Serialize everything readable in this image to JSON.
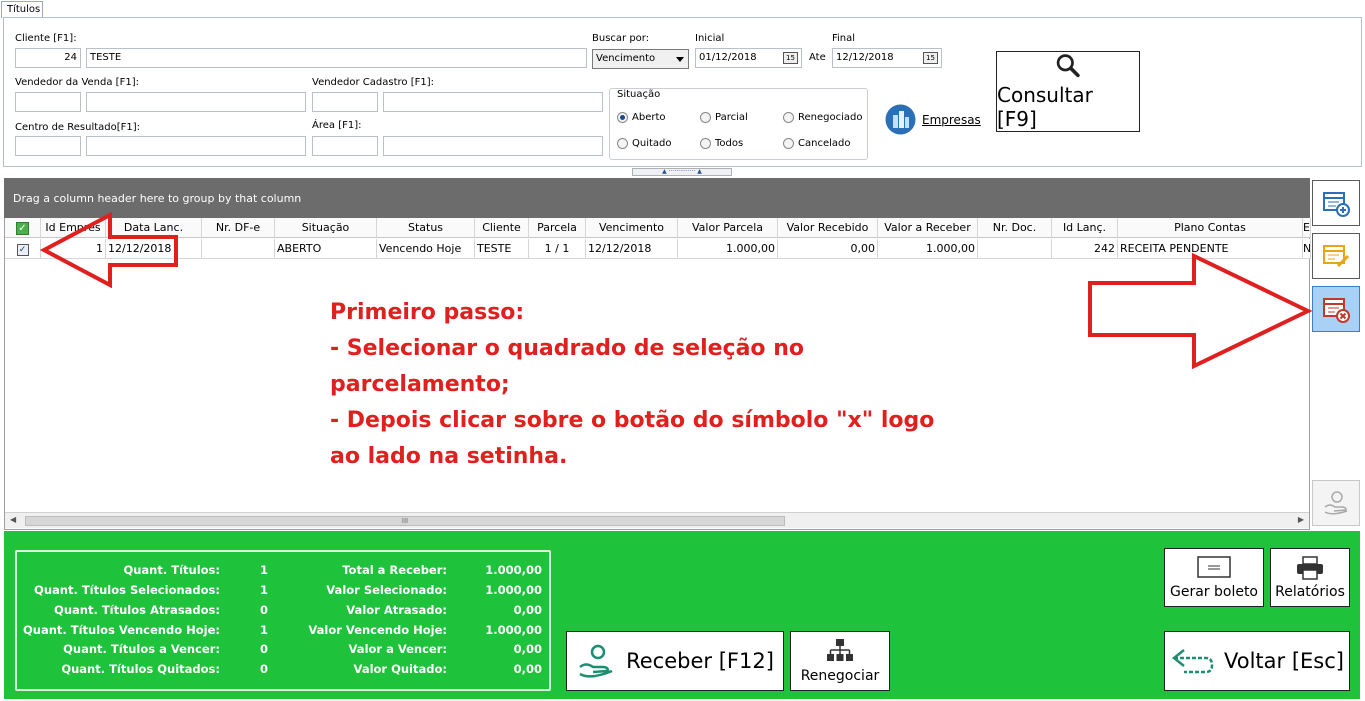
{
  "tab": "Títulos",
  "filters": {
    "cliente_label": "Cliente [F1]:",
    "cliente_id": "24",
    "cliente_nome": "TESTE",
    "buscar_label": "Buscar por:",
    "buscar_value": "Vencimento",
    "inicial_label": "Inicial",
    "inicial_value": "01/12/2018",
    "ate_label": "Ate",
    "final_label": "Final",
    "final_value": "12/12/2018",
    "cal_glyph": "15",
    "vendedor_venda_label": "Vendedor da Venda [F1]:",
    "vendedor_cadastro_label": "Vendedor Cadastro [F1]:",
    "centro_label": "Centro de Resultado[F1]:",
    "area_label": "Área [F1]:",
    "situacao_label": "Situação",
    "situacao": [
      "Aberto",
      "Parcial",
      "Renegociado",
      "Quitado",
      "Todos",
      "Cancelado"
    ],
    "situacao_selected": "Aberto",
    "empresas": "Empresas",
    "consultar": "Consultar [F9]"
  },
  "splitter": "▲ ·············· ▲",
  "grid": {
    "group_hint": "Drag a column header here to group by that column",
    "columns": [
      "Id Empres",
      "Data Lanc.",
      "Nr. DF-e",
      "Situação",
      "Status",
      "Cliente",
      "Parcela",
      "Vencimento",
      "Valor Parcela",
      "Valor Recebido",
      "Valor a Receber",
      "Nr. Doc.",
      "Id Lanç.",
      "Plano Contas",
      "E"
    ],
    "row": {
      "checked": true,
      "id_empresa": "1",
      "data_lanc": "12/12/2018",
      "nr_dfe": "",
      "situacao": "ABERTO",
      "status": "Vencendo Hoje",
      "cliente": "TESTE",
      "parcela": "1 / 1",
      "vencimento": "12/12/2018",
      "valor_parcela": "1.000,00",
      "valor_recebido": "0,00",
      "valor_a_receber": "1.000,00",
      "nr_doc": "",
      "id_lanc": "242",
      "plano_contas": "RECEITA PENDENTE",
      "e": "N"
    },
    "scroll_grip": "III"
  },
  "annotation": {
    "line1": "Primeiro passo:",
    "line2": "- Selecionar o quadrado de seleção no",
    "line3": "parcelamento;",
    "line4": "- Depois clicar sobre o botão do símbolo \"x\" logo",
    "line5": "ao lado na setinha.",
    "color": "#e01f1f"
  },
  "summary": {
    "left": [
      {
        "label": "Quant. Títulos:",
        "value": "1"
      },
      {
        "label": "Quant. Títulos Selecionados:",
        "value": "1"
      },
      {
        "label": "Quant. Títulos Atrasados:",
        "value": "0"
      },
      {
        "label": "Quant. Títulos Vencendo Hoje:",
        "value": "1"
      },
      {
        "label": "Quant. Títulos a Vencer:",
        "value": "0"
      },
      {
        "label": "Quant. Títulos Quitados:",
        "value": "0"
      }
    ],
    "right": [
      {
        "label": "Total a Receber:",
        "value": "1.000,00"
      },
      {
        "label": "Valor Selecionado:",
        "value": "1.000,00"
      },
      {
        "label": "Valor Atrasado:",
        "value": "0,00"
      },
      {
        "label": "Valor Vencendo Hoje:",
        "value": "1.000,00"
      },
      {
        "label": "Valor a Vencer:",
        "value": "0,00"
      },
      {
        "label": "Valor Quitado:",
        "value": "0,00"
      }
    ]
  },
  "buttons": {
    "receber": "Receber [F12]",
    "renegociar": "Renegociar",
    "gerar_boleto": "Gerar boleto",
    "relatorios": "Relatórios",
    "voltar": "Voltar [Esc]"
  },
  "colors": {
    "panel_green": "#1ec23b",
    "grid_bar": "#6c6c6c",
    "arrow_red": "#e01f1f",
    "side_blue": "#2a6fb8"
  }
}
